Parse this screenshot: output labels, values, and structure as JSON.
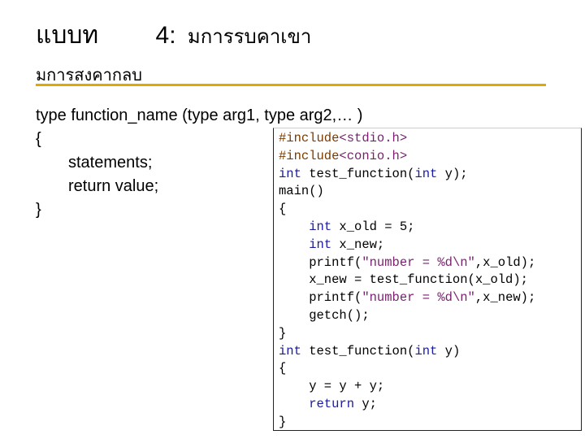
{
  "slide": {
    "title_word": "แบบท",
    "title_number": "4:",
    "title_rest": "มการรบคาเขา",
    "subtitle": "มการสงคากลบ",
    "rule_color": "#e0a800"
  },
  "prototype": {
    "signature": "type function_name (type arg1, type arg2,… )",
    "open_brace": "{",
    "statements": "statements;",
    "return_line": "return value;",
    "close_brace": "}"
  },
  "code": {
    "lines": [
      [
        {
          "t": "#include",
          "c": "brown"
        },
        {
          "t": "<stdio.h>",
          "c": "purple"
        }
      ],
      [
        {
          "t": "#include",
          "c": "brown"
        },
        {
          "t": "<conio.h>",
          "c": "purple"
        }
      ],
      [
        {
          "t": "int",
          "c": "blue"
        },
        {
          "t": " test_function(",
          "c": "black"
        },
        {
          "t": "int",
          "c": "blue"
        },
        {
          "t": " y);",
          "c": "black"
        }
      ],
      [
        {
          "t": "main()",
          "c": "black"
        }
      ],
      [
        {
          "t": "{",
          "c": "black"
        }
      ],
      [
        {
          "t": "    ",
          "c": "black"
        },
        {
          "t": "int",
          "c": "blue"
        },
        {
          "t": " x_old = 5;",
          "c": "black"
        }
      ],
      [
        {
          "t": "    ",
          "c": "black"
        },
        {
          "t": "int",
          "c": "blue"
        },
        {
          "t": " x_new;",
          "c": "black"
        }
      ],
      [
        {
          "t": "    printf(",
          "c": "black"
        },
        {
          "t": "\"number = %d\\n\"",
          "c": "purple"
        },
        {
          "t": ",x_old);",
          "c": "black"
        }
      ],
      [
        {
          "t": "    x_new = test_function(x_old);",
          "c": "black"
        }
      ],
      [
        {
          "t": "    printf(",
          "c": "black"
        },
        {
          "t": "\"number = %d\\n\"",
          "c": "purple"
        },
        {
          "t": ",x_new);",
          "c": "black"
        }
      ],
      [
        {
          "t": "    getch();",
          "c": "black"
        }
      ],
      [
        {
          "t": "}",
          "c": "black"
        }
      ],
      [
        {
          "t": "int",
          "c": "blue"
        },
        {
          "t": " test_function(",
          "c": "black"
        },
        {
          "t": "int",
          "c": "blue"
        },
        {
          "t": " y)",
          "c": "black"
        }
      ],
      [
        {
          "t": "{",
          "c": "black"
        }
      ],
      [
        {
          "t": "    y = y + y;",
          "c": "black"
        }
      ],
      [
        {
          "t": "    ",
          "c": "black"
        },
        {
          "t": "return",
          "c": "blue"
        },
        {
          "t": " y;",
          "c": "black"
        }
      ],
      [
        {
          "t": "}",
          "c": "black"
        }
      ]
    ]
  }
}
